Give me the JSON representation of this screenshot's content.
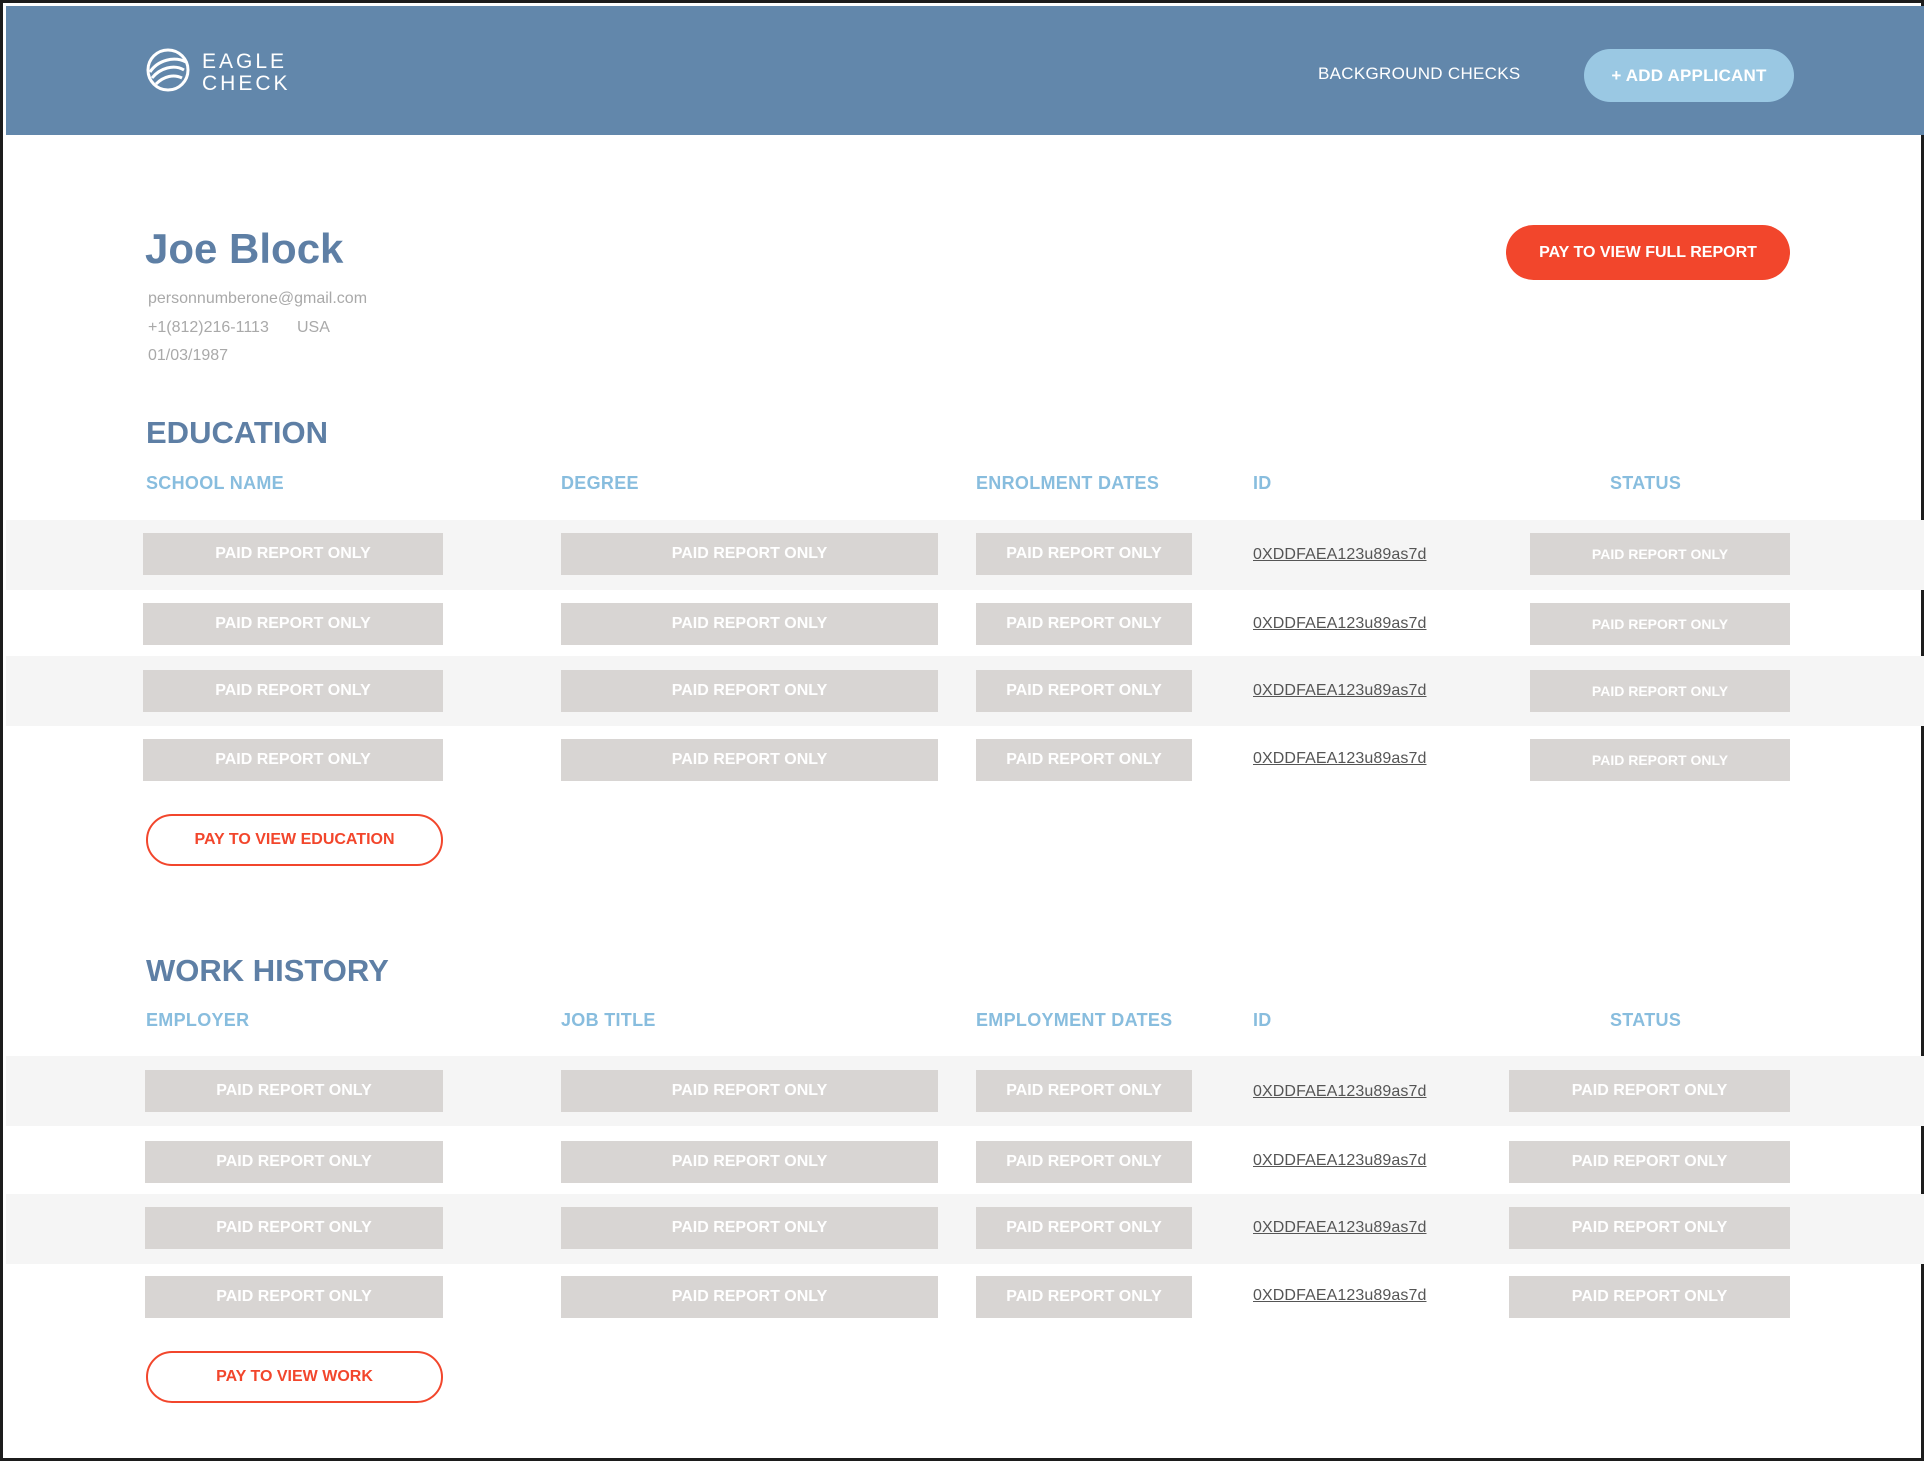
{
  "header": {
    "logo_line1": "EAGLE",
    "logo_line2": "CHECK",
    "nav_label": "BACKGROUND CHECKS",
    "add_label": "+ ADD APPLICANT",
    "colors": {
      "bar": "#6287ab",
      "add_button": "#9ac8e3"
    }
  },
  "profile": {
    "name": "Joe Block",
    "email": "personnumberone@gmail.com",
    "phone": "+1(812)216-1113",
    "country": "USA",
    "dob": "01/03/1987",
    "pay_full_label": "PAY TO VIEW FULL REPORT"
  },
  "education": {
    "title": "EDUCATION",
    "columns": [
      "SCHOOL NAME",
      "DEGREE",
      "ENROLMENT DATES",
      "ID",
      "STATUS"
    ],
    "rows": [
      {
        "school": "PAID REPORT ONLY",
        "degree": "PAID REPORT ONLY",
        "dates": "PAID REPORT ONLY",
        "id": "0XDDFAEA123u89as7d",
        "status": "PAID REPORT ONLY"
      },
      {
        "school": "PAID REPORT ONLY",
        "degree": "PAID REPORT ONLY",
        "dates": "PAID REPORT ONLY",
        "id": "0XDDFAEA123u89as7d",
        "status": "PAID REPORT ONLY"
      },
      {
        "school": "PAID REPORT ONLY",
        "degree": "PAID REPORT ONLY",
        "dates": "PAID REPORT ONLY",
        "id": "0XDDFAEA123u89as7d",
        "status": "PAID REPORT ONLY"
      },
      {
        "school": "PAID REPORT ONLY",
        "degree": "PAID REPORT ONLY",
        "dates": "PAID REPORT ONLY",
        "id": "0XDDFAEA123u89as7d",
        "status": "PAID REPORT ONLY"
      }
    ],
    "pay_label": "PAY TO VIEW EDUCATION"
  },
  "work": {
    "title": "WORK HISTORY",
    "columns": [
      "EMPLOYER",
      "JOB TITLE",
      "EMPLOYMENT DATES",
      "ID",
      "STATUS"
    ],
    "rows": [
      {
        "employer": "PAID REPORT ONLY",
        "job": "PAID REPORT ONLY",
        "dates": "PAID REPORT ONLY",
        "id": "0XDDFAEA123u89as7d",
        "status": "PAID REPORT ONLY"
      },
      {
        "employer": "PAID REPORT ONLY",
        "job": "PAID REPORT ONLY",
        "dates": "PAID REPORT ONLY",
        "id": "0XDDFAEA123u89as7d",
        "status": "PAID REPORT ONLY"
      },
      {
        "employer": "PAID REPORT ONLY",
        "job": "PAID REPORT ONLY",
        "dates": "PAID REPORT ONLY",
        "id": "0XDDFAEA123u89as7d",
        "status": "PAID REPORT ONLY"
      },
      {
        "employer": "PAID REPORT ONLY",
        "job": "PAID REPORT ONLY",
        "dates": "PAID REPORT ONLY",
        "id": "0XDDFAEA123u89as7d",
        "status": "PAID REPORT ONLY"
      }
    ],
    "pay_label": "PAY TO VIEW WORK"
  },
  "accent_color": "#f2462c"
}
